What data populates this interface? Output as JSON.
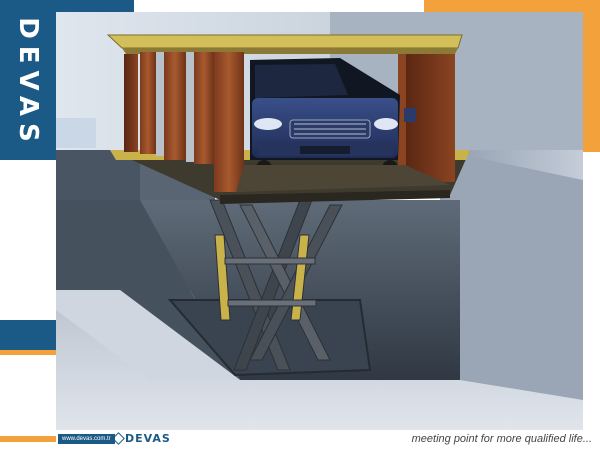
{
  "brand": {
    "name": "DEVAS",
    "footer_url": "www.devas.com.tr",
    "footer_logo": "DEVAS",
    "slogan": "meeting point for more qualified life..."
  },
  "colors": {
    "brand_blue": "#1b5a86",
    "accent_orange": "#f3a13a"
  },
  "illustration": {
    "subject": "scissor-lift-car-platform-icon"
  }
}
